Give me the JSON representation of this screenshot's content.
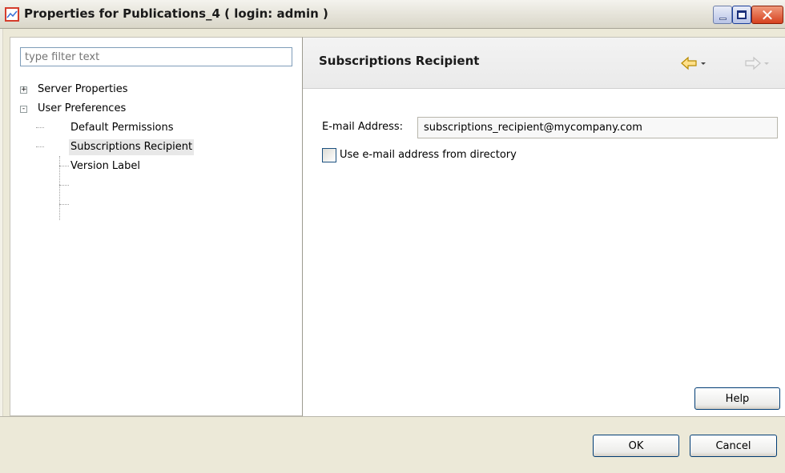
{
  "window": {
    "title": "Properties for Publications_4 ( login: admin )",
    "accent_color": "#d43c2c"
  },
  "filter": {
    "placeholder": "type filter text"
  },
  "tree": {
    "items": [
      {
        "label": "Server Properties",
        "expander": "+",
        "level": 0
      },
      {
        "label": "User Preferences",
        "expander": "-",
        "level": 0
      },
      {
        "label": "Default Permissions",
        "level": 1
      },
      {
        "label": "Subscriptions Recipient",
        "level": 1,
        "selected": true
      },
      {
        "label": "Version Label",
        "level": 1
      }
    ]
  },
  "page": {
    "title": "Subscriptions Recipient",
    "email_label": "E-mail Address:",
    "email_value": "subscriptions_recipient@mycompany.com",
    "checkbox_label": "Use e-mail address from directory",
    "checkbox_checked": false,
    "help_label": "Help"
  },
  "buttons": {
    "ok": "OK",
    "cancel": "Cancel"
  },
  "icons": {
    "app": "chart-icon",
    "back": "back-arrow-icon",
    "forward": "forward-arrow-icon",
    "minimize": "minimize-icon",
    "maximize": "maximize-icon",
    "close": "close-icon"
  }
}
